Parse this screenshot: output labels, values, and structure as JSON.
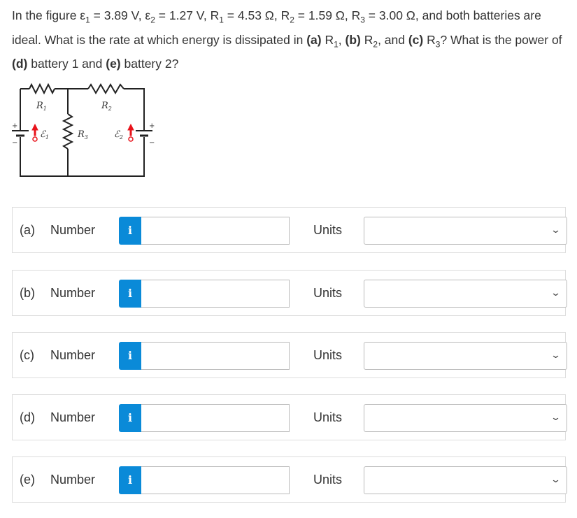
{
  "question": {
    "p1": "In the figure ε",
    "s1": "1",
    "p2": " = 3.89 V, ε",
    "s2": "2",
    "p3": " = 1.27 V, R",
    "s3": "1",
    "p4": " = 4.53 Ω, R",
    "s4": "2",
    "p5": " = 1.59 Ω, R",
    "s5": "3",
    "p6": " = 3.00 Ω, and both batteries are ideal. What is the rate at which energy is dissipated in ",
    "a": "(a)",
    "p7": " R",
    "s7": "1",
    "p8": ", ",
    "b": "(b)",
    "p9": " R",
    "s9": "2",
    "p10": ", and ",
    "c": "(c)",
    "p11": " R",
    "s11": "3",
    "p12": "? What is the power of ",
    "d": "(d)",
    "p13": " battery 1 and ",
    "e": "(e)",
    "p14": " battery 2?"
  },
  "circuit": {
    "r1": "R",
    "r1_sub": "1",
    "r2": "R",
    "r2_sub": "2",
    "r3": "R",
    "r3_sub": "3",
    "e1": "ℰ",
    "e1_sub": "1",
    "e2": "ℰ",
    "e2_sub": "2",
    "plus": "+",
    "minus": "−",
    "arrow_color": "#e8131b"
  },
  "answers": [
    {
      "part": "(a)",
      "label": "Number",
      "info": "i",
      "value": "",
      "units_label": "Units",
      "units_value": ""
    },
    {
      "part": "(b)",
      "label": "Number",
      "info": "i",
      "value": "",
      "units_label": "Units",
      "units_value": ""
    },
    {
      "part": "(c)",
      "label": "Number",
      "info": "i",
      "value": "",
      "units_label": "Units",
      "units_value": ""
    },
    {
      "part": "(d)",
      "label": "Number",
      "info": "i",
      "value": "",
      "units_label": "Units",
      "units_value": ""
    },
    {
      "part": "(e)",
      "label": "Number",
      "info": "i",
      "value": "",
      "units_label": "Units",
      "units_value": ""
    }
  ],
  "chevron": "⌄",
  "colors": {
    "info_button": "#0a8ad8"
  }
}
